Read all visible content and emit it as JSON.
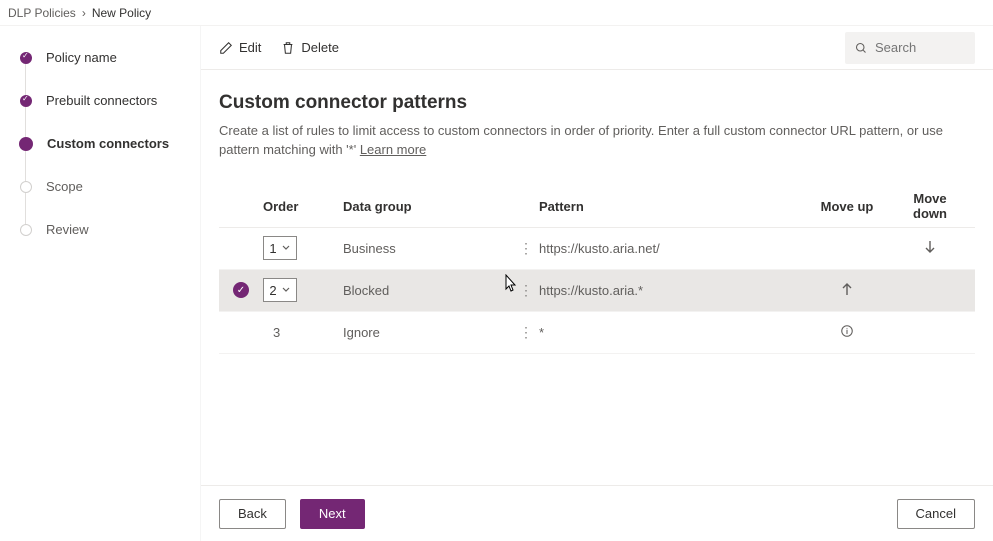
{
  "breadcrumb": {
    "parent": "DLP Policies",
    "current": "New Policy"
  },
  "sidebar": {
    "items": [
      {
        "label": "Policy name",
        "state": "done"
      },
      {
        "label": "Prebuilt connectors",
        "state": "done"
      },
      {
        "label": "Custom connectors",
        "state": "active"
      },
      {
        "label": "Scope",
        "state": "todo"
      },
      {
        "label": "Review",
        "state": "todo"
      }
    ]
  },
  "toolbar": {
    "edit_label": "Edit",
    "delete_label": "Delete",
    "search_placeholder": "Search"
  },
  "page": {
    "title": "Custom connector patterns",
    "description_pre": "Create a list of rules to limit access to custom connectors in order of priority. Enter a full custom connector URL pattern, or use pattern matching with '*' ",
    "learn_more": "Learn more"
  },
  "table": {
    "headers": {
      "order": "Order",
      "data_group": "Data group",
      "pattern": "Pattern",
      "move_up": "Move up",
      "move_down": "Move down"
    },
    "rows": [
      {
        "selected": false,
        "order": "1",
        "order_dropdown": true,
        "data_group": "Business",
        "pattern": "https://kusto.aria.net/",
        "move_up": false,
        "move_down": true,
        "info": false
      },
      {
        "selected": true,
        "order": "2",
        "order_dropdown": true,
        "data_group": "Blocked",
        "pattern": "https://kusto.aria.*",
        "move_up": true,
        "move_down": false,
        "info": false
      },
      {
        "selected": false,
        "order": "3",
        "order_dropdown": false,
        "data_group": "Ignore",
        "pattern": "*",
        "move_up": false,
        "move_down": false,
        "info": true
      }
    ]
  },
  "footer": {
    "back_label": "Back",
    "next_label": "Next",
    "cancel_label": "Cancel"
  }
}
